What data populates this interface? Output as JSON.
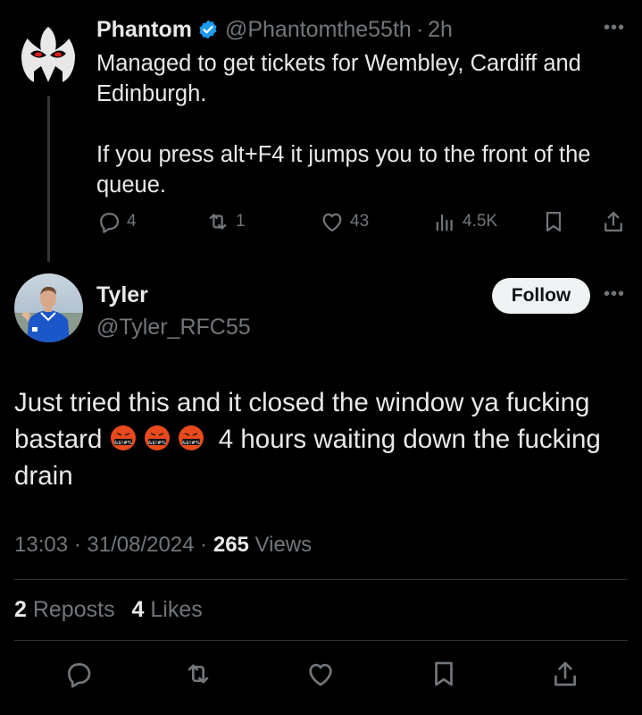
{
  "parent": {
    "name": "Phantom",
    "handle": "@Phantomthe55th",
    "time": "2h",
    "text": "Managed to get tickets for Wembley, Cardiff and Edinburgh.\n\nIf you press alt+F4 it jumps you to the front of the queue.",
    "actions": {
      "replies": "4",
      "reposts": "1",
      "likes": "43",
      "views": "4.5K"
    }
  },
  "reply": {
    "name": "Tyler",
    "handle": "@Tyler_RFC55",
    "follow_label": "Follow",
    "text_part1": "Just tried this and it closed the window ya fucking bastard ",
    "emoji_label": "&$!#%",
    "text_part2": " 4 hours waiting down the fucking drain",
    "timestamp": "13:03 · 31/08/2024 · ",
    "views_count": "265",
    "views_label": " Views",
    "reposts_count": "2",
    "reposts_label": " Reposts",
    "likes_count": "4",
    "likes_label": " Likes"
  },
  "colors": {
    "background": "#000000",
    "text": "#e7e9ea",
    "muted": "#71767b",
    "verified": "#1d9bf0",
    "follow_bg": "#eff3f4"
  },
  "icons": [
    "reply-icon",
    "repost-icon",
    "like-icon",
    "views-icon",
    "bookmark-icon",
    "share-icon",
    "verified-badge-icon",
    "more-icon"
  ]
}
